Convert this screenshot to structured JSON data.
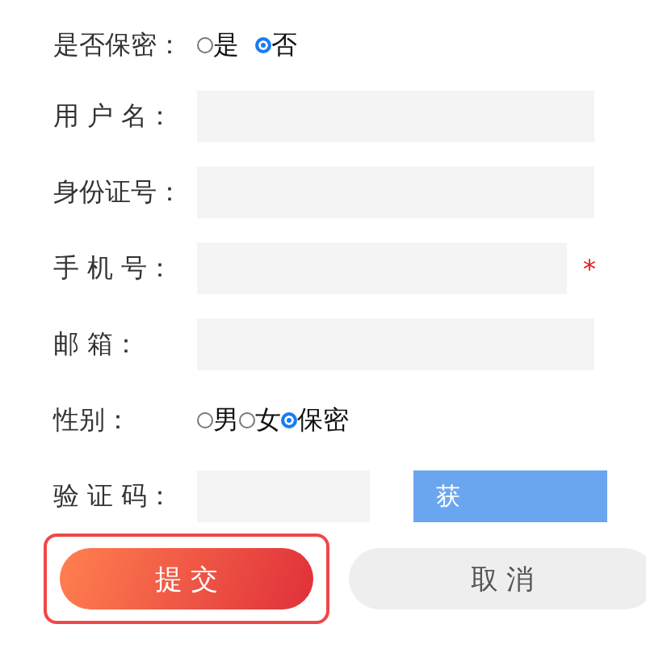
{
  "rows": [
    {
      "kind": "radio",
      "label": "是否保密：",
      "options": [
        {
          "label": "是",
          "selected": false
        },
        {
          "label": "否",
          "selected": true
        }
      ],
      "spaced": true
    },
    {
      "kind": "input",
      "label": "用 户 名：",
      "required": false
    },
    {
      "kind": "input",
      "label": "身份证号：",
      "required": false
    },
    {
      "kind": "input",
      "label": "手 机 号：",
      "required": true,
      "mark": "*"
    },
    {
      "kind": "input",
      "label": "邮 箱：",
      "required": false
    },
    {
      "kind": "radio",
      "label": "性别：",
      "options": [
        {
          "label": "男",
          "selected": false
        },
        {
          "label": "女",
          "selected": false
        },
        {
          "label": "保密",
          "selected": true
        }
      ],
      "spaced": false
    },
    {
      "kind": "code",
      "label": "验 证 码：",
      "button": "获"
    }
  ],
  "actions": [
    {
      "kind": "primary",
      "label": "提 交",
      "highlighted": true
    },
    {
      "kind": "secondary",
      "label": "取 消",
      "highlighted": false
    }
  ]
}
